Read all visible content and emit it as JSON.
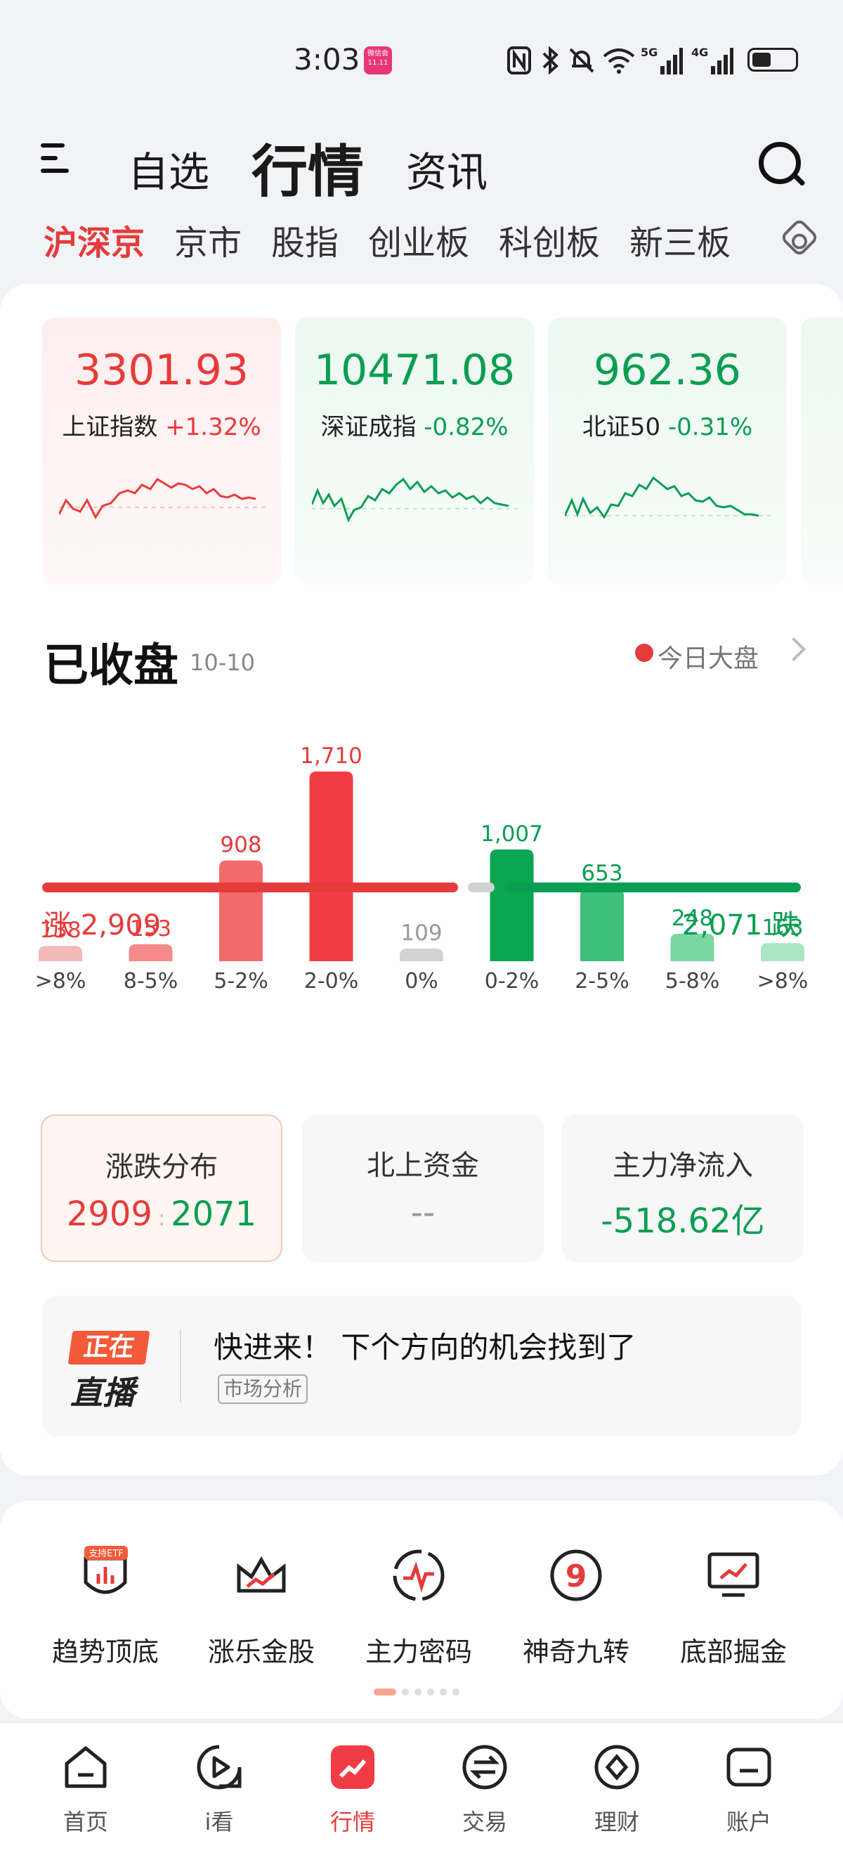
{
  "status_bar": {
    "time": "3:03",
    "badge_top": "微信会",
    "badge_bottom": "11.11"
  },
  "header": {
    "tabs": [
      {
        "label": "自选",
        "active": false
      },
      {
        "label": "行情",
        "active": true
      },
      {
        "label": "资讯",
        "active": false
      }
    ]
  },
  "subtabs": [
    {
      "label": "沪深京",
      "active": true
    },
    {
      "label": "京市"
    },
    {
      "label": "股指"
    },
    {
      "label": "创业板"
    },
    {
      "label": "科创板"
    },
    {
      "label": "新三板"
    }
  ],
  "indices": [
    {
      "value": "3301.93",
      "name": "上证指数",
      "change": "+1.32%",
      "trend": "up"
    },
    {
      "value": "10471.08",
      "name": "深证成指",
      "change": "-0.82%",
      "trend": "down"
    },
    {
      "value": "962.36",
      "name": "北证50",
      "change": "-0.31%",
      "trend": "down"
    }
  ],
  "market_section": {
    "title": "已收盘",
    "date": "10-10",
    "link_label": "今日大盘"
  },
  "chart_data": {
    "type": "bar",
    "categories": [
      ">8%",
      "8-5%",
      "5-2%",
      "2-0%",
      "0%",
      "0-2%",
      "2-5%",
      "5-8%",
      ">8%"
    ],
    "values": [
      138,
      153,
      908,
      1710,
      109,
      1007,
      653,
      248,
      163
    ],
    "value_labels": [
      "138",
      "153",
      "908",
      "1,710",
      "109",
      "1,007",
      "653",
      "248",
      "163"
    ],
    "colors": [
      "#f6b9b9",
      "#f48a8a",
      "#f26b6b",
      "#f23c45",
      "#d2d2d2",
      "#0aa652",
      "#3cc07a",
      "#7ad7a2",
      "#a8e6c3"
    ],
    "label_colors": [
      "#e63b3b",
      "#e63b3b",
      "#e63b3b",
      "#e63b3b",
      "#999999",
      "#0a9e52",
      "#0a9e52",
      "#0a9e52",
      "#0a9e52"
    ],
    "rise_label": "涨 2,909",
    "fall_label": "2,071 跌",
    "rise_total": 2909,
    "flat_total": 109,
    "fall_total": 2071
  },
  "stats": [
    {
      "label": "涨跌分布",
      "rise": "2909",
      "fall": "2071",
      "active": true
    },
    {
      "label": "北上资金",
      "value": "--"
    },
    {
      "label": "主力净流入",
      "value": "-518.62亿"
    }
  ],
  "live": {
    "badge_top": "正在",
    "badge_bottom": "直播",
    "title": "快进来！ 下个方向的机会找到了",
    "tag": "市场分析"
  },
  "features": [
    {
      "label": "趋势顶底",
      "icon": "shield-chart-icon",
      "badge": "支持ETF"
    },
    {
      "label": "涨乐金股",
      "icon": "crown-icon"
    },
    {
      "label": "主力密码",
      "icon": "pulse-icon"
    },
    {
      "label": "神奇九转",
      "icon": "nine-icon"
    },
    {
      "label": "底部掘金",
      "icon": "monitor-chart-icon"
    }
  ],
  "bottom_nav": [
    {
      "label": "首页",
      "icon": "home-icon"
    },
    {
      "label": "i看",
      "icon": "play-icon"
    },
    {
      "label": "行情",
      "icon": "market-icon",
      "active": true
    },
    {
      "label": "交易",
      "icon": "exchange-icon"
    },
    {
      "label": "理财",
      "icon": "wealth-icon"
    },
    {
      "label": "账户",
      "icon": "account-icon"
    }
  ],
  "colors": {
    "up": "#e63b3b",
    "down": "#0a9e52",
    "accent": "#e63b3b"
  }
}
